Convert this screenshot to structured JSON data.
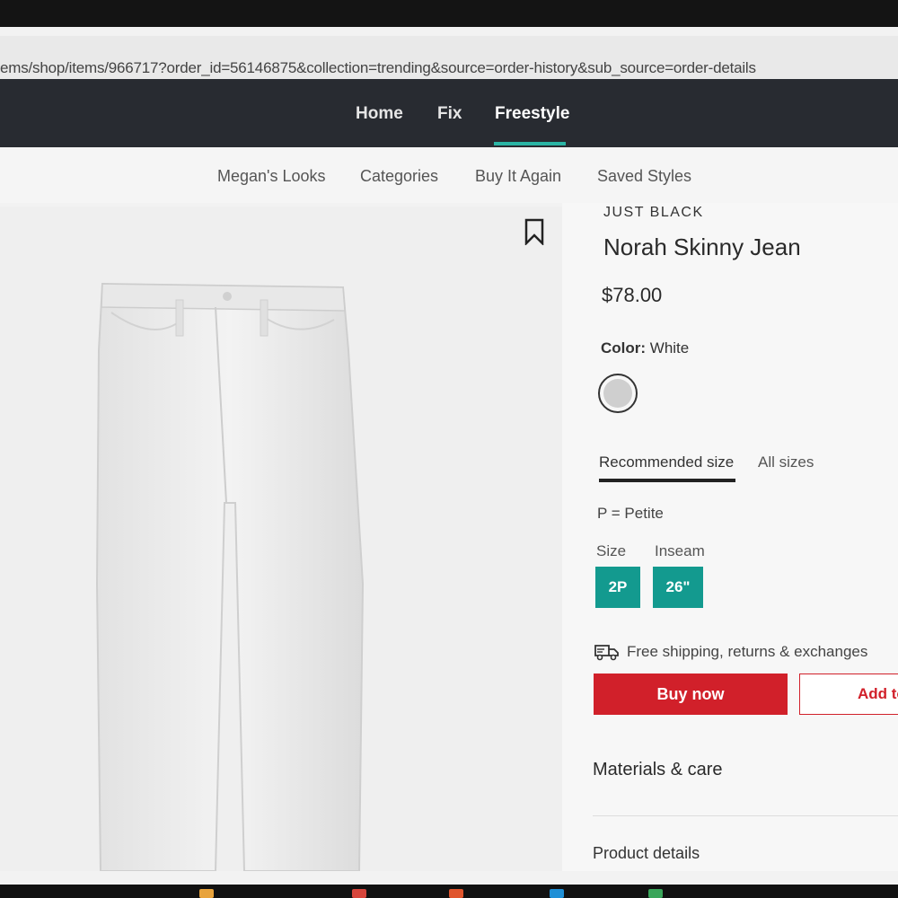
{
  "browser": {
    "url": "ems/shop/items/966717?order_id=56146875&collection=trending&source=order-history&sub_source=order-details"
  },
  "top_nav": {
    "items": [
      {
        "label": "Home"
      },
      {
        "label": "Fix"
      },
      {
        "label": "Freestyle",
        "active": true
      }
    ],
    "accent": "#2bb5a5"
  },
  "sub_nav": {
    "items": [
      {
        "label": "Megan's Looks"
      },
      {
        "label": "Categories"
      },
      {
        "label": "Buy It Again"
      },
      {
        "label": "Saved Styles"
      }
    ]
  },
  "product": {
    "brand": "JUST BLACK",
    "name": "Norah Skinny Jean",
    "price": "$78.00",
    "color_label": "Color:",
    "color_value": "White",
    "swatch_color": "#cfcfcf",
    "size_tabs": [
      {
        "label": "Recommended size",
        "active": true
      },
      {
        "label": "All sizes"
      }
    ],
    "petite_note": "P = Petite",
    "size_label": "Size",
    "inseam_label": "Inseam",
    "size_value": "2P",
    "inseam_value": "26\"",
    "shipping_text": "Free shipping, returns & exchanges",
    "buy_label": "Buy now",
    "add_label": "Add to",
    "materials_label": "Materials & care",
    "details_label": "Product details"
  },
  "colors": {
    "teal": "#139a8f",
    "red": "#d1202a",
    "nav_bg": "#282b31"
  }
}
